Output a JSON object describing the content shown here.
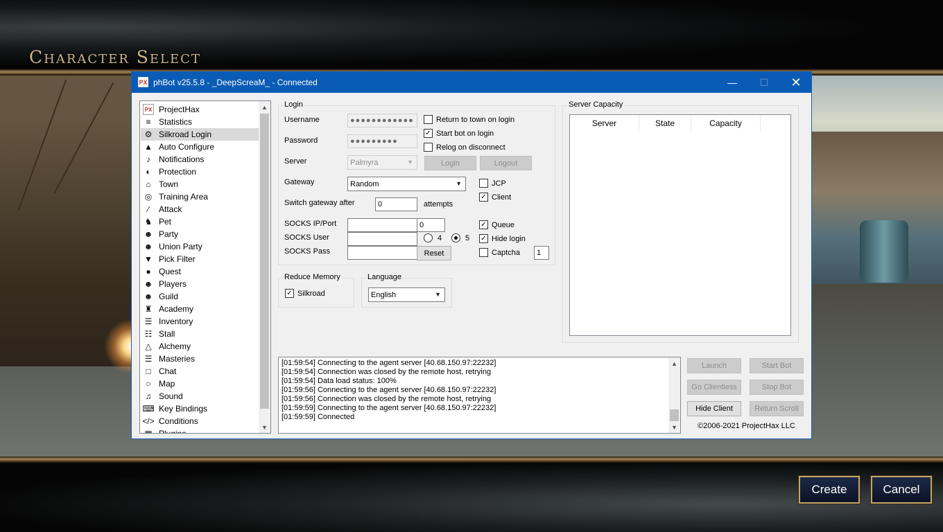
{
  "game": {
    "title": "Character Select",
    "create_label": "Create",
    "cancel_label": "Cancel"
  },
  "window": {
    "icon_text": "PX",
    "title": "phBot v25.5.8 - _DeepScreaM_ - Connected",
    "minimize_icon": "minimize-icon",
    "maximize_icon": "maximize-icon",
    "close_icon": "close-icon"
  },
  "sidebar": {
    "items": [
      {
        "label": "ProjectHax",
        "icon": "px-logo-icon"
      },
      {
        "label": "Statistics",
        "icon": "statistics-icon"
      },
      {
        "label": "Silkroad Login",
        "icon": "login-icon",
        "selected": true
      },
      {
        "label": "Auto Configure",
        "icon": "auto-configure-icon"
      },
      {
        "label": "Notifications",
        "icon": "bell-icon"
      },
      {
        "label": "Protection",
        "icon": "shield-icon"
      },
      {
        "label": "Town",
        "icon": "town-icon"
      },
      {
        "label": "Training Area",
        "icon": "target-icon"
      },
      {
        "label": "Attack",
        "icon": "sword-icon"
      },
      {
        "label": "Pet",
        "icon": "pet-icon"
      },
      {
        "label": "Party",
        "icon": "party-icon"
      },
      {
        "label": "Union Party",
        "icon": "union-party-icon"
      },
      {
        "label": "Pick Filter",
        "icon": "filter-icon"
      },
      {
        "label": "Quest",
        "icon": "quest-icon"
      },
      {
        "label": "Players",
        "icon": "players-icon"
      },
      {
        "label": "Guild",
        "icon": "guild-icon"
      },
      {
        "label": "Academy",
        "icon": "academy-icon"
      },
      {
        "label": "Inventory",
        "icon": "inventory-icon"
      },
      {
        "label": "Stall",
        "icon": "stall-icon"
      },
      {
        "label": "Alchemy",
        "icon": "alchemy-icon"
      },
      {
        "label": "Masteries",
        "icon": "masteries-icon"
      },
      {
        "label": "Chat",
        "icon": "chat-icon"
      },
      {
        "label": "Map",
        "icon": "map-pin-icon"
      },
      {
        "label": "Sound",
        "icon": "sound-icon"
      },
      {
        "label": "Key Bindings",
        "icon": "keyboard-icon"
      },
      {
        "label": "Conditions",
        "icon": "code-icon"
      },
      {
        "label": "Plugins",
        "icon": "plugins-icon"
      }
    ]
  },
  "login": {
    "legend": "Login",
    "username_label": "Username",
    "username_value": "●●●●●●●●●●●●",
    "password_label": "Password",
    "password_value": "●●●●●●●●●",
    "server_label": "Server",
    "server_value": "Palmyra",
    "login_button": "Login",
    "logout_button": "Logout",
    "gateway_label": "Gateway",
    "gateway_value": "Random",
    "switch_gateway_label": "Switch gateway after",
    "switch_gateway_value": "0",
    "attempts_label": "attempts",
    "socks_ip_label": "SOCKS IP/Port",
    "socks_ip_value": "",
    "socks_port_value": "0",
    "socks_user_label": "SOCKS User",
    "socks_user_value": "",
    "socks_pass_label": "SOCKS Pass",
    "socks_pass_value": "",
    "socks4_label": "4",
    "socks5_label": "5",
    "socks_version": "5",
    "reset_button": "Reset",
    "return_to_town_label": "Return to town on login",
    "return_to_town": false,
    "start_bot_label": "Start bot on login",
    "start_bot": true,
    "relog_label": "Relog on disconnect",
    "relog": false,
    "jcp_label": "JCP",
    "jcp": false,
    "client_label": "Client",
    "client": true,
    "queue_label": "Queue",
    "queue": true,
    "hide_login_label": "Hide login",
    "hide_login": true,
    "captcha_label": "Captcha",
    "captcha": false,
    "captcha_value": "1"
  },
  "reduce_memory": {
    "legend": "Reduce Memory",
    "silkroad_label": "Silkroad",
    "silkroad": true
  },
  "language": {
    "legend": "Language",
    "value": "English"
  },
  "server_capacity": {
    "legend": "Server Capacity",
    "columns": [
      "Server",
      "State",
      "Capacity"
    ]
  },
  "log": {
    "lines": [
      "[01:59:54] Connecting to the agent server [40.68.150.97:22232]",
      "[01:59:54] Connection was closed by the remote host, retrying",
      "[01:59:54] Data load status: 100%",
      "[01:59:56] Connecting to the agent server [40.68.150.97:22232]",
      "[01:59:56] Connection was closed by the remote host, retrying",
      "[01:59:59] Connecting to the agent server [40.68.150.97:22232]",
      "[01:59:59] Connected"
    ]
  },
  "actions": {
    "launch": "Launch",
    "start_bot": "Start Bot",
    "go_clientless": "Go Clientless",
    "stop_bot": "Stop Bot",
    "hide_client": "Hide Client",
    "return_scroll": "Return Scroll"
  },
  "copyright": "©2006-2021 ProjectHax LLC"
}
